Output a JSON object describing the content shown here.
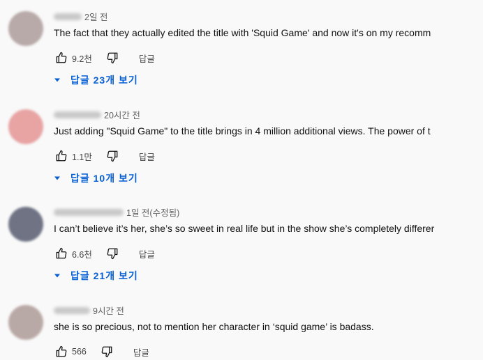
{
  "comments": [
    {
      "time": "2일 전",
      "text": "The fact that they actually edited the title with 'Squid Game' and now it's on my recomm",
      "likes": "9.2천",
      "reply_label": "답글",
      "replies_label": "답글 23개 보기",
      "avatar_color": "#b8aaa8"
    },
    {
      "time": "20시간 전",
      "text": "Just adding \"Squid Game\" to the title brings in 4 million additional views. The power of t",
      "likes": "1.1만",
      "reply_label": "답글",
      "replies_label": "답글 10개 보기",
      "avatar_color": "#e8a3a3"
    },
    {
      "time": "1일 전(수정됨)",
      "text": "I can’t believe it’s her, she’s so sweet in real life but in the show she’s completely differer",
      "likes": "6.6천",
      "reply_label": "답글",
      "replies_label": "답글 21개 보기",
      "avatar_color": "#6f7384"
    },
    {
      "time": "9시간 전",
      "text": "she is so precious, not to mention her character in ‘squid game’ is badass.",
      "likes": "566",
      "reply_label": "답글",
      "replies_label": null,
      "avatar_color": "#b9a9a6"
    }
  ],
  "colors": {
    "link": "#065fd4",
    "meta": "#606060"
  }
}
